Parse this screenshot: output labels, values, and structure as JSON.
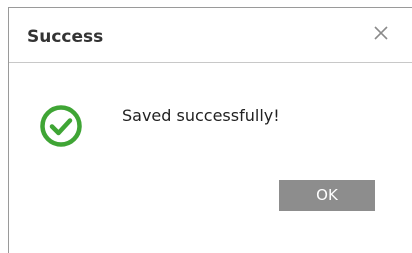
{
  "dialog": {
    "title": "Success",
    "close_icon": "close-icon",
    "status_icon": "check-circle-icon",
    "message": "Saved successfully!",
    "ok_label": "OK"
  },
  "colors": {
    "success": "#3fa535",
    "button_bg": "#8d8d8d",
    "button_text": "#ffffff",
    "title_text": "#333333"
  }
}
